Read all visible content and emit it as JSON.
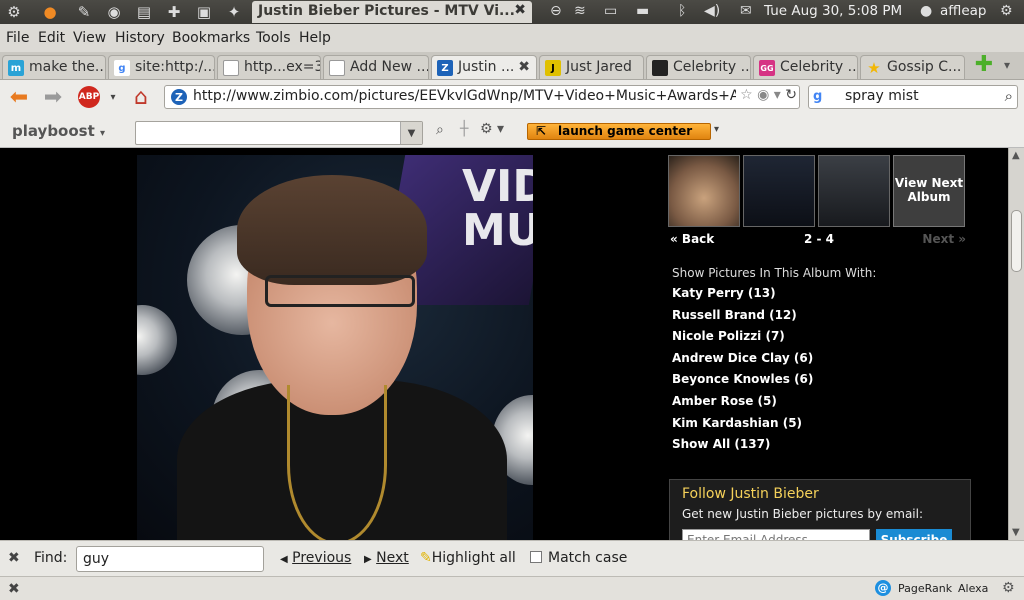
{
  "topbar": {
    "window_title": "Justin Bieber Pictures - MTV Vi...",
    "clock": "Tue Aug 30,  5:08 PM",
    "user": "affleap"
  },
  "menu": [
    "File",
    "Edit",
    "View",
    "History",
    "Bookmarks",
    "Tools",
    "Help"
  ],
  "tabs": [
    {
      "label": "make the...",
      "icon_text": "m",
      "icon_color": "#2aa3d6"
    },
    {
      "label": "site:http:/...",
      "icon_text": "g",
      "icon_color": "#4285f4"
    },
    {
      "label": "http...ex=3",
      "icon_text": "",
      "icon_color": "#ffffff"
    },
    {
      "label": "Add New ...",
      "icon_text": "",
      "icon_color": "#ffffff"
    },
    {
      "label": "Justin ...",
      "icon_text": "Z",
      "icon_color": "#1e63b8"
    },
    {
      "label": "Just Jared",
      "icon_text": "J",
      "icon_color": "#e0c000"
    },
    {
      "label": "Celebrity ...",
      "icon_text": "",
      "icon_color": "#222222"
    },
    {
      "label": "Celebrity ...",
      "icon_text": "GG",
      "icon_color": "#d63384"
    },
    {
      "label": "Gossip C...",
      "icon_text": "★",
      "icon_color": "#f2b705"
    }
  ],
  "nav": {
    "url": "http://www.zimbio.com/pictures/EEVkvlGdWnp/MTV+Video+Music+Awards+Arriv",
    "search_value": "spray mist",
    "search_engine_icon": "g"
  },
  "playboost": {
    "logo": "playboost",
    "game_center": "launch game center"
  },
  "photo": {
    "vma_text": "VID\nMU"
  },
  "album": {
    "next_album": "View Next Album",
    "back": "« Back",
    "range": "2 - 4",
    "next": "Next »",
    "show_with": "Show Pictures In This Album With:",
    "people": [
      "Katy Perry (13)",
      "Russell Brand (12)",
      "Nicole Polizzi (7)",
      "Andrew Dice Clay (6)",
      "Beyonce Knowles (6)",
      "Amber Rose (5)",
      "Kim Kardashian (5)",
      "Show All (137)"
    ]
  },
  "follow": {
    "title": "Follow Justin Bieber",
    "desc": "Get new Justin Bieber pictures by email:",
    "email_placeholder": "Enter Email Address",
    "subscribe": "Subscribe"
  },
  "findbar": {
    "label": "Find:",
    "value": "guy",
    "previous": "Previous",
    "next": "Next",
    "highlight": "Highlight all",
    "match_case": "Match case"
  },
  "status": {
    "pagerank": "PageRank",
    "alexa": "Alexa"
  }
}
